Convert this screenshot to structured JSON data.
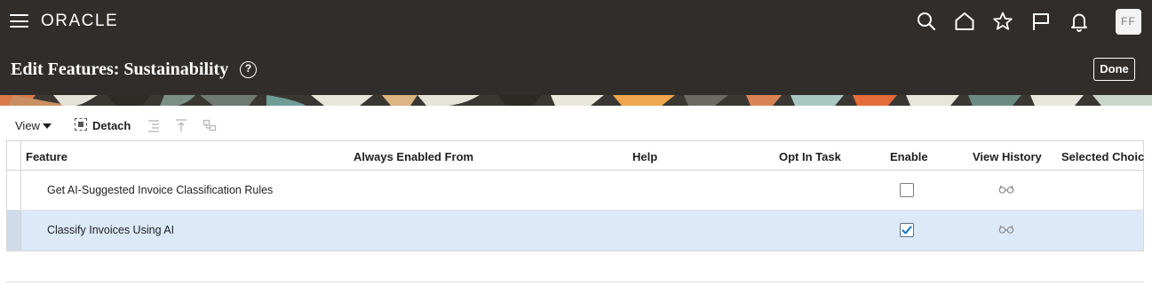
{
  "header": {
    "logo_text": "ORACLE",
    "avatar_initials": "FF",
    "icons": [
      "menu-icon",
      "search-icon",
      "home-icon",
      "star-icon",
      "flag-icon",
      "bell-icon"
    ]
  },
  "page": {
    "title": "Edit Features: Sustainability",
    "help_symbol": "?",
    "done_label": "Done"
  },
  "toolbar": {
    "view_label": "View",
    "detach_label": "Detach"
  },
  "table": {
    "columns": [
      "Feature",
      "Always Enabled From",
      "Help",
      "Opt In Task",
      "Enable",
      "View History",
      "Selected Choic"
    ],
    "rows": [
      {
        "feature": "Get AI-Suggested Invoice Classification Rules",
        "enabled": false,
        "selected": false
      },
      {
        "feature": "Classify Invoices Using AI",
        "enabled": true,
        "selected": true
      }
    ]
  },
  "colors": {
    "header_bg": "#312d2a",
    "selected_row_bg": "#dbe9f8",
    "checkbox_check": "#0572ce"
  }
}
